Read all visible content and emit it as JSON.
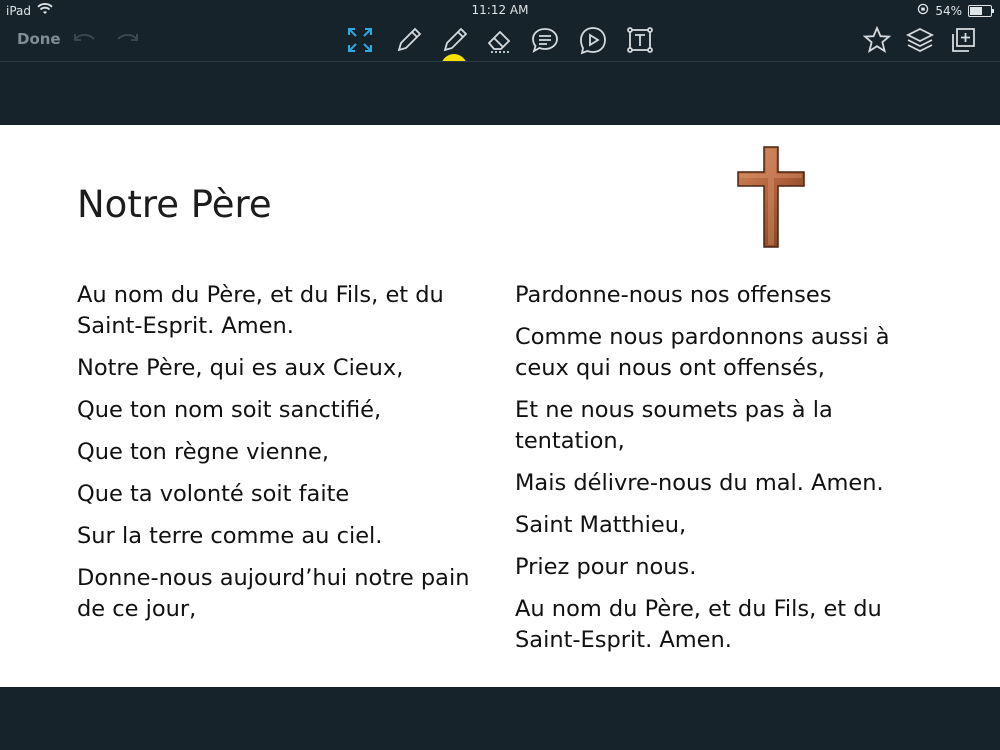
{
  "status": {
    "device": "iPad",
    "time": "11:12 AM",
    "battery": "54%",
    "battery_level": 0.54
  },
  "toolbar": {
    "done": "Done",
    "pen_color": "#f6e000"
  },
  "slide": {
    "title": "Notre Père",
    "left_lines": [
      "Au nom du Père, et du Fils, et du Saint-Esprit. Amen.",
      "Notre Père, qui es aux Cieux,",
      "Que ton nom soit sanctifié,",
      "Que ton règne vienne,",
      "Que ta volonté soit faite",
      "Sur la terre comme au ciel.",
      "Donne-nous aujourd’hui notre pain de ce jour,"
    ],
    "right_lines": [
      "Pardonne-nous nos offenses",
      "Comme nous pardonnons aussi à ceux qui nous ont offensés,",
      "Et ne nous soumets pas à la tentation,",
      "Mais délivre-nous du mal. Amen.",
      "Saint Matthieu,",
      "Priez pour nous.",
      "Au nom du Père, et du Fils, et du Saint-Esprit. Amen."
    ]
  },
  "colors": {
    "background": "#16232a",
    "accent": "#2ea8e0",
    "slide_bg": "#ffffff"
  }
}
